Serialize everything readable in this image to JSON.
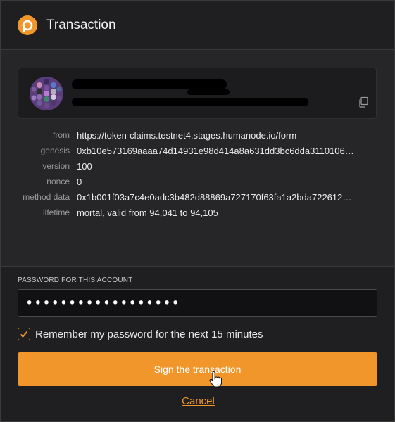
{
  "header": {
    "title": "Transaction",
    "logo_icon": "polkadot-logo-icon",
    "accent_color": "#f0962a"
  },
  "account": {
    "name": "",
    "address": "",
    "copy_icon": "copy-icon",
    "identicon": "polkadot-identicon"
  },
  "details": [
    {
      "label": "from",
      "value": "https://token-claims.testnet4.stages.humanode.io/form"
    },
    {
      "label": "genesis",
      "value": "0xb10e573169aaaa74d14931e98d414a8a631dd3bc6dda3110106…"
    },
    {
      "label": "version",
      "value": "100"
    },
    {
      "label": "nonce",
      "value": "0"
    },
    {
      "label": "method data",
      "value": "0x1b001f03a7c4e0adc3b482d88869a727170f63fa1a2bda722612…"
    },
    {
      "label": "lifetime",
      "value": "mortal, valid from 94,041 to 94,105"
    }
  ],
  "password": {
    "label": "PASSWORD FOR THIS ACCOUNT",
    "value": "••••••••••••••••••"
  },
  "remember": {
    "label": "Remember my password for the next 15 minutes",
    "checked": true
  },
  "actions": {
    "sign_label": "Sign the transaction",
    "cancel_label": "Cancel"
  }
}
